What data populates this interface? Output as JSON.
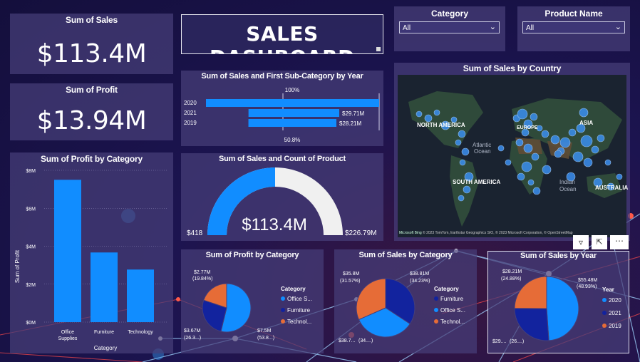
{
  "colors": {
    "card": "#463e78",
    "bar": "#118dff",
    "navy": "#12239e",
    "orange": "#e66c37",
    "lightgrey": "#f0f0f0"
  },
  "kpi_sales": {
    "title": "Sum of Sales",
    "value": "$113.4M"
  },
  "kpi_profit": {
    "title": "Sum of Profit",
    "value": "$13.94M"
  },
  "dashboard_title": "SALES DASHBOARD",
  "slicer_category": {
    "title": "Category",
    "value": "All"
  },
  "slicer_product": {
    "title": "Product Name",
    "value": "All"
  },
  "map": {
    "title": "Sum of Sales by Country",
    "labels": {
      "north_america": "NORTH AMERICA",
      "south_america": "SOUTH AMERICA",
      "asia": "ASIA",
      "australia": "AUSTRALIA",
      "atlantic": "Atlantic",
      "atlantic2": "Ocean",
      "indian": "Indian",
      "indian2": "Ocean",
      "europe": "EUROPE"
    },
    "attribution": "© 2023 TomTom, Earthstar Geographics SIO, © 2023 Microsoft Corporation, © OpenStreetMap",
    "ms_logo": "Microsoft Bing"
  },
  "chart_data": [
    {
      "type": "bar",
      "title": "Sum of Sales and First Sub-Category by Year",
      "categories": [
        "2020",
        "2021",
        "2019"
      ],
      "values": [
        100,
        52.4,
        50.8
      ],
      "data_labels": [
        "",
        "$29.71M",
        "$28.21M"
      ],
      "top_label": "100%",
      "bottom_label": "50.8%"
    },
    {
      "type": "gauge",
      "title": "Sum of Sales and Count of Product",
      "value": "$113.4M",
      "min": "$418",
      "max": "$226.79M",
      "fraction": 0.5
    },
    {
      "type": "bar",
      "title": "Sum of Profit by Category",
      "categories": [
        "Office Supplies",
        "Furniture",
        "Technology"
      ],
      "values": [
        7.5,
        3.67,
        2.77
      ],
      "ylabel": "Sum of Profit",
      "xlabel": "Category",
      "yticks": [
        "$0M",
        "$2M",
        "$4M",
        "$6M",
        "$8M"
      ],
      "ylim": [
        0,
        8
      ],
      "grid": true
    },
    {
      "type": "pie",
      "title": "Sum of Profit by Category",
      "legend_title": "Category",
      "series": [
        {
          "name": "Office S...",
          "value": 7.5,
          "color": "#118dff"
        },
        {
          "name": "Furniture",
          "value": 3.67,
          "color": "#12239e"
        },
        {
          "name": "Technol...",
          "value": 2.77,
          "color": "#e66c37"
        }
      ],
      "labels": [
        "$7.5M",
        "(53.8...)",
        "$3.67M",
        "(26.3...)",
        "$2.77M",
        "(19.84%)"
      ]
    },
    {
      "type": "pie",
      "title": "Sum of Sales by Category",
      "legend_title": "Category",
      "series": [
        {
          "name": "Furniture",
          "value": 38.81,
          "color": "#12239e"
        },
        {
          "name": "Office S...",
          "value": 38.7,
          "color": "#118dff"
        },
        {
          "name": "Technol...",
          "value": 35.8,
          "color": "#e66c37"
        }
      ],
      "labels": [
        "$38.81M",
        "(34.23%)",
        "$38.7...",
        "(34....)",
        "$35.8M",
        "(31.57%)"
      ]
    },
    {
      "type": "pie",
      "title": "Sum of Sales by Year",
      "legend_title": "Year",
      "series": [
        {
          "name": "2020",
          "value": 55.48,
          "color": "#118dff"
        },
        {
          "name": "2021",
          "value": 29.71,
          "color": "#12239e"
        },
        {
          "name": "2019",
          "value": 28.21,
          "color": "#e66c37"
        }
      ],
      "labels": [
        "$55.48M",
        "(48.93%)",
        "$28.21M",
        "(24.88%)",
        "$29....",
        "(26....)"
      ]
    }
  ]
}
